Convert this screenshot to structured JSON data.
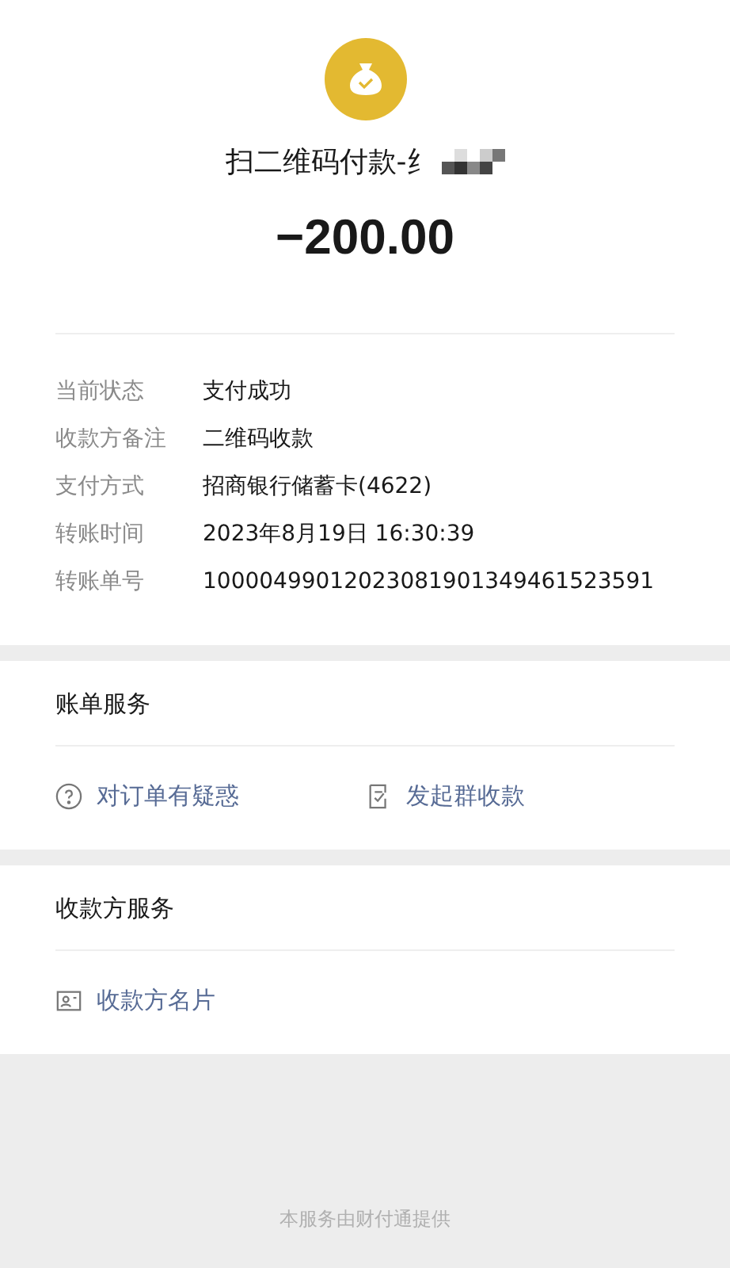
{
  "header": {
    "title": "扫二维码付款-纟",
    "amount": "−200.00"
  },
  "details": [
    {
      "label": "当前状态",
      "value": "支付成功"
    },
    {
      "label": "收款方备注",
      "value": "二维码收款"
    },
    {
      "label": "支付方式",
      "value": "招商银行储蓄卡(4622)"
    },
    {
      "label": "转账时间",
      "value": "2023年8月19日 16:30:39"
    },
    {
      "label": "转账单号",
      "value": "10000499012023081901349461523591"
    }
  ],
  "sections": [
    {
      "title": "账单服务",
      "actions": [
        {
          "kind": "question",
          "label": "对订单有疑惑"
        },
        {
          "kind": "bill",
          "label": "发起群收款"
        }
      ]
    },
    {
      "title": "收款方服务",
      "actions": [
        {
          "kind": "card",
          "label": "收款方名片"
        }
      ]
    }
  ],
  "footer": "本服务由财付通提供"
}
